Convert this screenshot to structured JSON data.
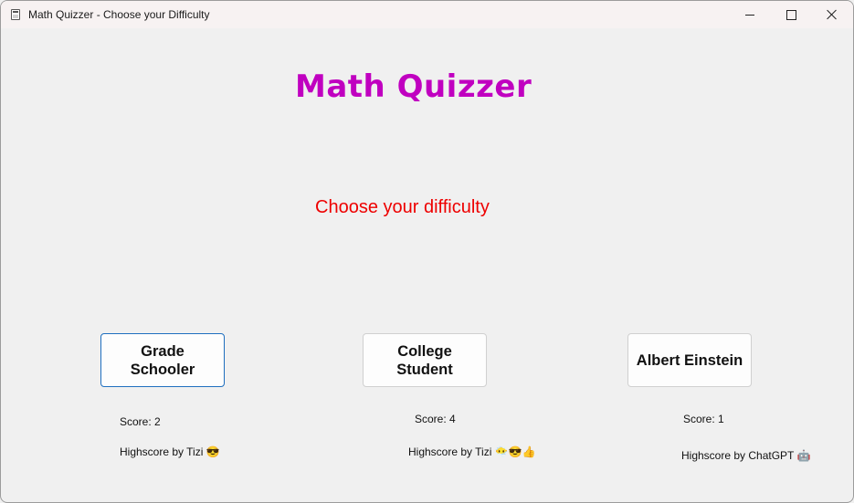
{
  "window": {
    "title": "Math Quizzer - Choose your Difficulty",
    "icon": "calculator-icon",
    "controls": [
      "minimize-icon",
      "maximize-icon",
      "close-icon"
    ]
  },
  "main": {
    "title": "Math Quizzer",
    "subtitle": "Choose your difficulty",
    "title_color": "#c000c0",
    "subtitle_color": "#ee0000"
  },
  "difficulties": [
    {
      "label": "Grade\nSchooler",
      "score": "Score: 2",
      "highscore": "Highscore by Tizi 😎"
    },
    {
      "label": "College\nStudent",
      "score": "Score: 4",
      "highscore": "Highscore by Tizi 😶‍🌫️😎👍"
    },
    {
      "label": "Albert Einstein",
      "score": "Score: 1",
      "highscore": "Highscore by ChatGPT 🤖"
    }
  ],
  "colors": {
    "focused_border": "#1f6fbf"
  }
}
